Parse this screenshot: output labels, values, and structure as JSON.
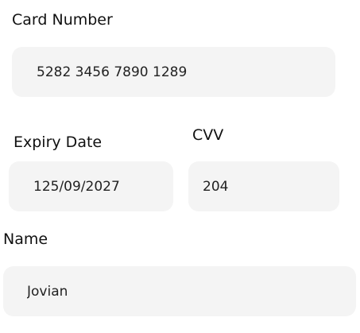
{
  "card_number": {
    "label": "Card Number",
    "value": "5282 3456 7890 1289"
  },
  "expiry_date": {
    "label": "Expiry Date",
    "value": "125/09/2027"
  },
  "cvv": {
    "label": "CVV",
    "value": "204"
  },
  "name": {
    "label": "Name",
    "value": "Jovian"
  },
  "colors": {
    "field_background": "#f4f4f4",
    "label_text": "#111111",
    "value_text": "#222222"
  }
}
